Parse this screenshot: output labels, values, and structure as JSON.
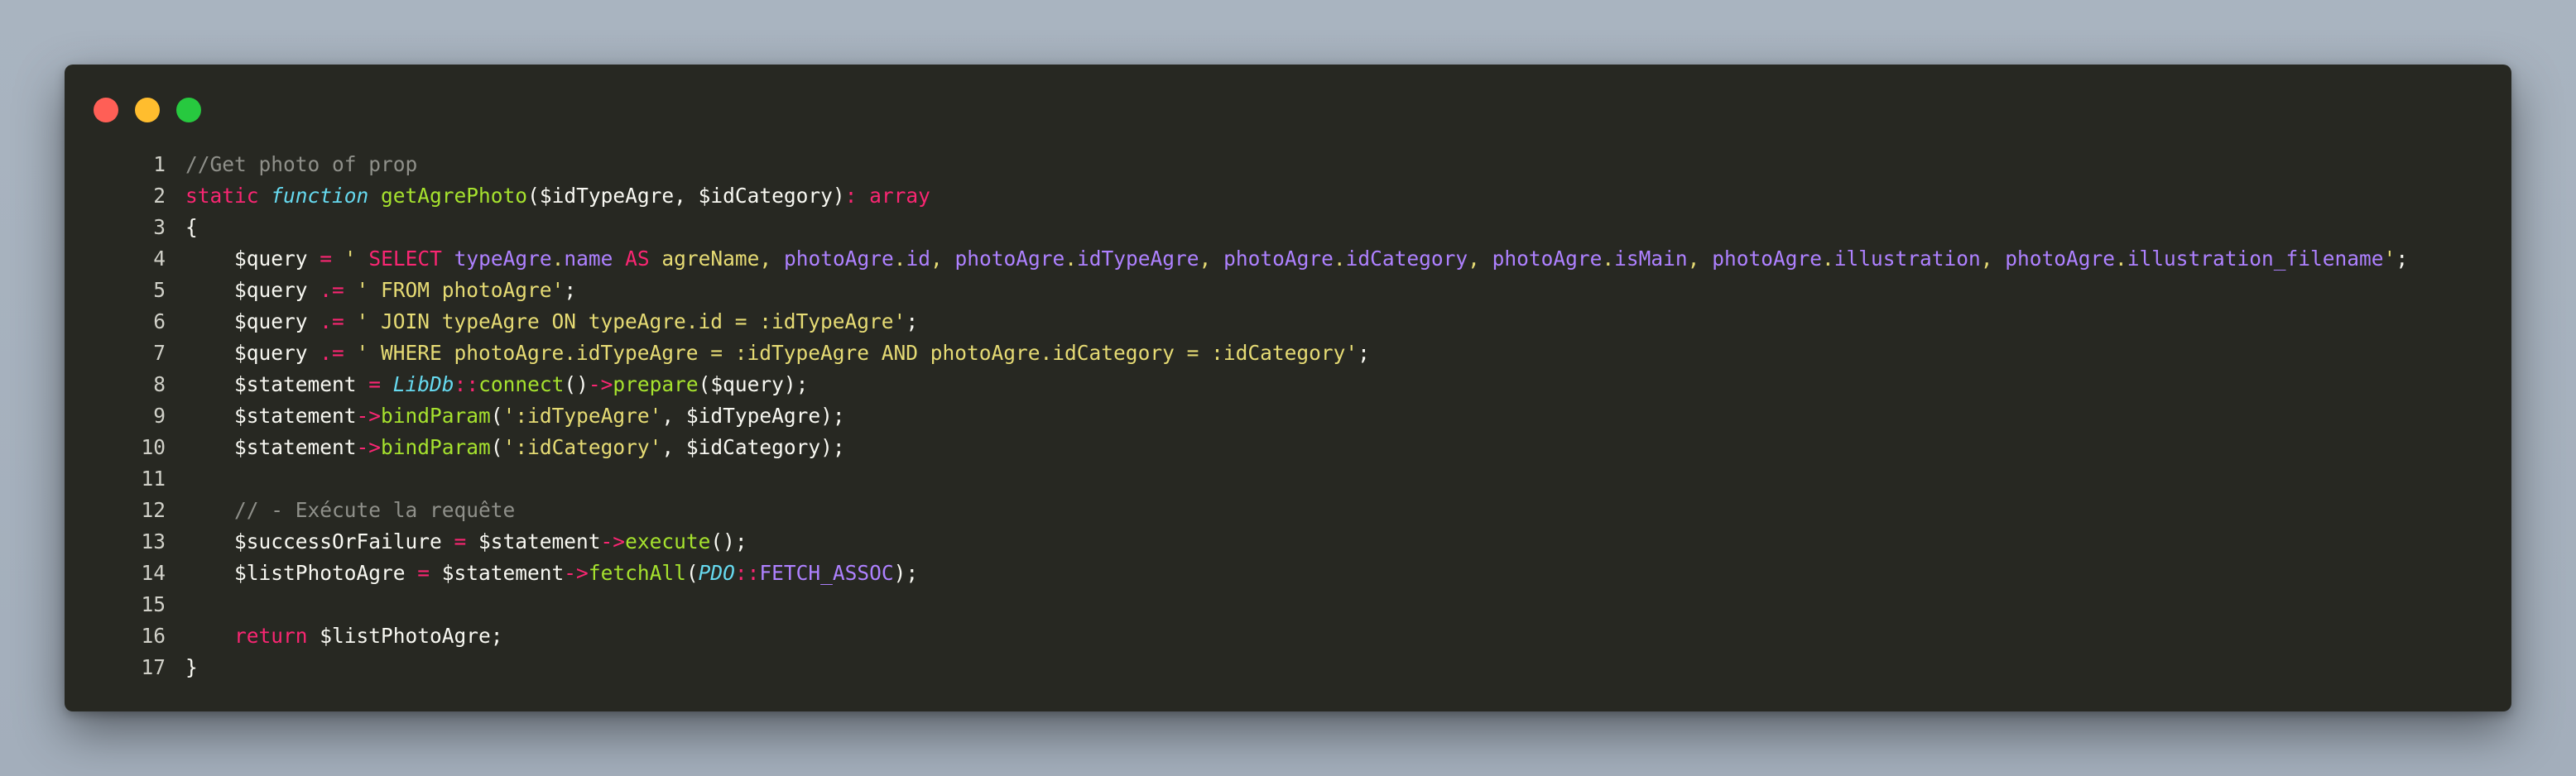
{
  "window_controls": [
    "close",
    "minimize",
    "maximize"
  ],
  "colors": {
    "background": "#272822",
    "comment": "#8f908a",
    "keyword": "#f92672",
    "string": "#e6db74",
    "function": "#a6e22e",
    "type": "#66d9ef",
    "property": "#ae81ff",
    "plain": "#f8f8f2"
  },
  "lines": [
    {
      "n": "1",
      "tokens": [
        [
          "c",
          "//Get photo of prop"
        ]
      ]
    },
    {
      "n": "2",
      "tokens": [
        [
          "k",
          "static "
        ],
        [
          "t",
          "function"
        ],
        [
          "v",
          " "
        ],
        [
          "f",
          "getAgrePhoto"
        ],
        [
          "v",
          "($idTypeAgre, $idCategory)"
        ],
        [
          "k",
          ": array"
        ]
      ]
    },
    {
      "n": "3",
      "tokens": [
        [
          "v",
          "{"
        ]
      ]
    },
    {
      "n": "4",
      "tokens": [
        [
          "v",
          "    $query "
        ],
        [
          "k",
          "="
        ],
        [
          "v",
          " "
        ],
        [
          "s",
          "' "
        ],
        [
          "k",
          "SELECT"
        ],
        [
          "s",
          " "
        ],
        [
          "p",
          "typeAgre"
        ],
        [
          "s",
          "."
        ],
        [
          "p",
          "name"
        ],
        [
          "s",
          " "
        ],
        [
          "k",
          "AS"
        ],
        [
          "s",
          " agreName, "
        ],
        [
          "p",
          "photoAgre"
        ],
        [
          "s",
          "."
        ],
        [
          "p",
          "id"
        ],
        [
          "s",
          ", "
        ],
        [
          "p",
          "photoAgre"
        ],
        [
          "s",
          "."
        ],
        [
          "p",
          "idTypeAgre"
        ],
        [
          "s",
          ", "
        ],
        [
          "p",
          "photoAgre"
        ],
        [
          "s",
          "."
        ],
        [
          "p",
          "idCategory"
        ],
        [
          "s",
          ", "
        ],
        [
          "p",
          "photoAgre"
        ],
        [
          "s",
          "."
        ],
        [
          "p",
          "isMain"
        ],
        [
          "s",
          ", "
        ],
        [
          "p",
          "photoAgre"
        ],
        [
          "s",
          "."
        ],
        [
          "p",
          "illustration"
        ],
        [
          "s",
          ", "
        ],
        [
          "p",
          "photoAgre"
        ],
        [
          "s",
          "."
        ],
        [
          "p",
          "illustration_filename"
        ],
        [
          "s",
          "'"
        ],
        [
          "v",
          ";"
        ]
      ]
    },
    {
      "n": "5",
      "tokens": [
        [
          "v",
          "    $query "
        ],
        [
          "k",
          ".="
        ],
        [
          "v",
          " "
        ],
        [
          "s",
          "' FROM photoAgre'"
        ],
        [
          "v",
          ";"
        ]
      ]
    },
    {
      "n": "6",
      "tokens": [
        [
          "v",
          "    $query "
        ],
        [
          "k",
          ".="
        ],
        [
          "v",
          " "
        ],
        [
          "s",
          "' JOIN typeAgre ON typeAgre.id = :idTypeAgre'"
        ],
        [
          "v",
          ";"
        ]
      ]
    },
    {
      "n": "7",
      "tokens": [
        [
          "v",
          "    $query "
        ],
        [
          "k",
          ".="
        ],
        [
          "v",
          " "
        ],
        [
          "s",
          "' WHERE photoAgre.idTypeAgre = :idTypeAgre AND photoAgre.idCategory = :idCategory'"
        ],
        [
          "v",
          ";"
        ]
      ]
    },
    {
      "n": "8",
      "tokens": [
        [
          "v",
          "    $statement "
        ],
        [
          "k",
          "="
        ],
        [
          "v",
          " "
        ],
        [
          "t",
          "LibDb"
        ],
        [
          "k",
          "::"
        ],
        [
          "f",
          "connect"
        ],
        [
          "v",
          "()"
        ],
        [
          "k",
          "->"
        ],
        [
          "f",
          "prepare"
        ],
        [
          "v",
          "($query);"
        ]
      ]
    },
    {
      "n": "9",
      "tokens": [
        [
          "v",
          "    $statement"
        ],
        [
          "k",
          "->"
        ],
        [
          "f",
          "bindParam"
        ],
        [
          "v",
          "("
        ],
        [
          "s",
          "':idTypeAgre'"
        ],
        [
          "v",
          ", $idTypeAgre);"
        ]
      ]
    },
    {
      "n": "10",
      "tokens": [
        [
          "v",
          "    $statement"
        ],
        [
          "k",
          "->"
        ],
        [
          "f",
          "bindParam"
        ],
        [
          "v",
          "("
        ],
        [
          "s",
          "':idCategory'"
        ],
        [
          "v",
          ", $idCategory);"
        ]
      ]
    },
    {
      "n": "11",
      "tokens": []
    },
    {
      "n": "12",
      "tokens": [
        [
          "c",
          "    // - Exécute la requête"
        ]
      ]
    },
    {
      "n": "13",
      "tokens": [
        [
          "v",
          "    $successOrFailure "
        ],
        [
          "k",
          "="
        ],
        [
          "v",
          " $statement"
        ],
        [
          "k",
          "->"
        ],
        [
          "f",
          "execute"
        ],
        [
          "v",
          "();"
        ]
      ]
    },
    {
      "n": "14",
      "tokens": [
        [
          "v",
          "    $listPhotoAgre "
        ],
        [
          "k",
          "="
        ],
        [
          "v",
          " $statement"
        ],
        [
          "k",
          "->"
        ],
        [
          "f",
          "fetchAll"
        ],
        [
          "v",
          "("
        ],
        [
          "t",
          "PDO"
        ],
        [
          "k",
          "::"
        ],
        [
          "p",
          "FETCH_ASSOC"
        ],
        [
          "v",
          ");"
        ]
      ]
    },
    {
      "n": "15",
      "tokens": []
    },
    {
      "n": "16",
      "tokens": [
        [
          "v",
          "    "
        ],
        [
          "k",
          "return"
        ],
        [
          "v",
          " $listPhotoAgre;"
        ]
      ]
    },
    {
      "n": "17",
      "tokens": [
        [
          "v",
          "}"
        ]
      ]
    }
  ]
}
